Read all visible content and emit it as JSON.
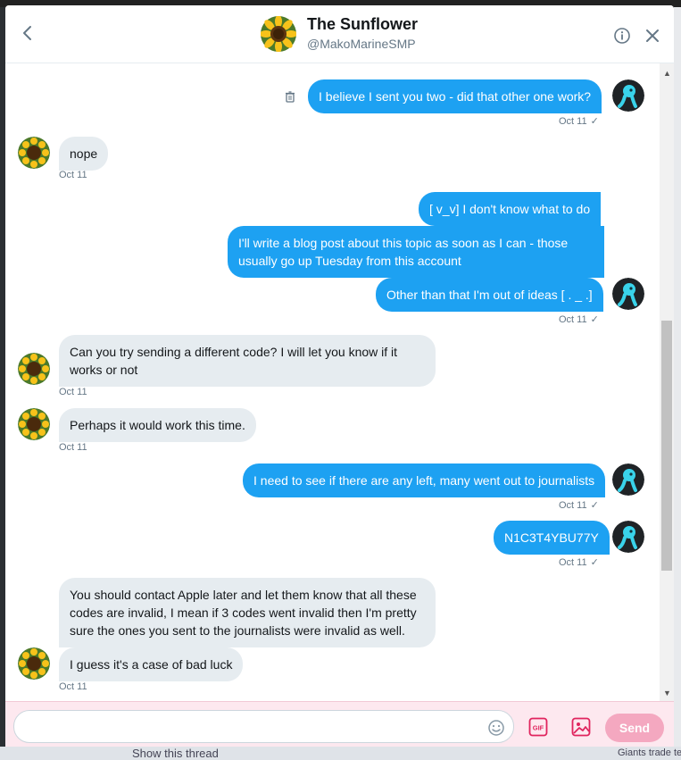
{
  "header": {
    "title": "The Sunflower",
    "handle": "@MakoMarineSMP"
  },
  "messages": [
    {
      "dir": "out",
      "text": "I believe I sent you two - did that other one work?",
      "time": "Oct 11",
      "check": "✓"
    },
    {
      "dir": "in",
      "text": "nope",
      "time": "Oct 11"
    },
    {
      "dir": "out",
      "text": "[ v_v] I don't know what to do"
    },
    {
      "dir": "out",
      "text": "I'll write a blog post about this topic as soon as I can - those usually go up Tuesday from this account"
    },
    {
      "dir": "out",
      "text": "Other than that I'm out of ideas [ . _ .]",
      "time": "Oct 11",
      "check": "✓"
    },
    {
      "dir": "in",
      "text": "Can you try sending a different code? I will let you know if it works or not",
      "time": "Oct 11"
    },
    {
      "dir": "in",
      "text": "Perhaps it would work this time.",
      "time": "Oct 11"
    },
    {
      "dir": "out",
      "text": "I need to see if there are any left, many went out to journalists",
      "time": "Oct 11",
      "check": "✓"
    },
    {
      "dir": "out",
      "text": "N1C3T4YBU77Y",
      "time": "Oct 11",
      "check": "✓"
    },
    {
      "dir": "in",
      "text": "You should contact Apple later and let them know that all these codes are invalid, I mean if 3 codes went invalid then I'm pretty sure the ones you sent to the journalists were invalid as well."
    },
    {
      "dir": "in",
      "text": "I guess it's a case of bad luck",
      "time": "Oct 11"
    }
  ],
  "composer": {
    "placeholder": "",
    "value": "",
    "send_label": "Send",
    "gif_label": "GIF"
  },
  "background": {
    "bottom_text": "Show this thread",
    "bottom_right_text": "Giants trade te"
  },
  "colors": {
    "accent": "#1da1f2",
    "incoming_bubble": "#e6ecf0",
    "composer_bg": "#fde8ef",
    "send_button": "#f4a8c0",
    "icon_pink": "#e0245e"
  },
  "icons": {
    "back": "chevron-left-icon",
    "info": "info-icon",
    "close": "close-icon",
    "delete": "trash-icon",
    "emoji": "emoji-icon",
    "gif": "gif-icon",
    "image": "image-icon"
  }
}
